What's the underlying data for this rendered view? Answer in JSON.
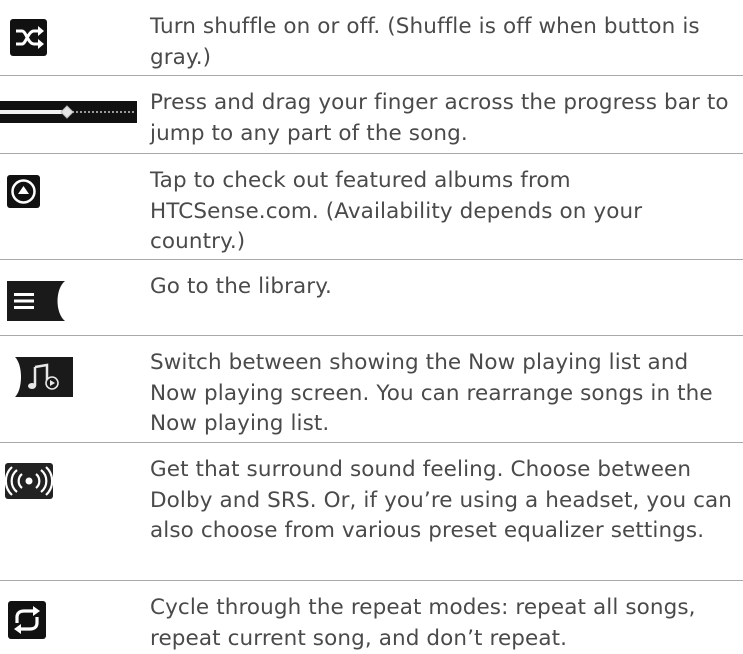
{
  "rows": [
    {
      "icon": "shuffle-icon",
      "text": "Turn shuffle on or off. (Shuffle is off when button is gray.)"
    },
    {
      "icon": "progress-bar-icon",
      "text": "Press and drag your finger across the progress bar to jump to any part of the song."
    },
    {
      "icon": "featured-albums-icon",
      "text": "Tap to check out featured albums from HTCSense.com. (Availability depends on your country.)"
    },
    {
      "icon": "library-icon",
      "text": "Go to the library."
    },
    {
      "icon": "now-playing-toggle-icon",
      "text": "Switch between showing the Now playing list and Now playing screen. You can rearrange songs in the Now playing list."
    },
    {
      "icon": "surround-sound-icon",
      "text": "Get that surround sound feeling. Choose between Dolby and SRS. Or, if you’re using a headset, you can also choose from various preset equalizer settings."
    },
    {
      "icon": "repeat-icon",
      "text": "Cycle through the repeat modes: repeat all songs, repeat current song, and don’t repeat."
    }
  ]
}
